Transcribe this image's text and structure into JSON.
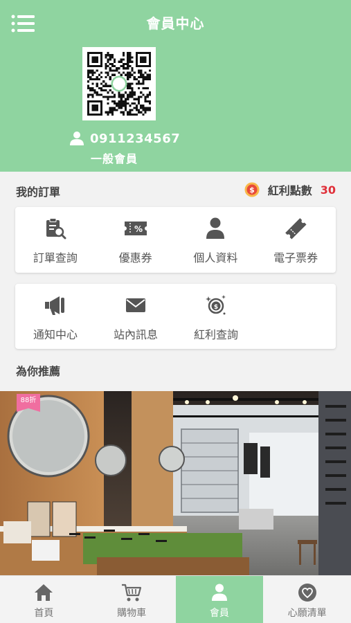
{
  "header": {
    "title": "會員中心",
    "phone": "0911234567",
    "member_level": "一般會員"
  },
  "orders": {
    "title": "我的訂單",
    "bonus_label": "紅利點數",
    "bonus_value": "30"
  },
  "grid_row1": [
    {
      "label": "訂單查詢",
      "icon": "order-search-icon"
    },
    {
      "label": "優惠券",
      "icon": "coupon-icon"
    },
    {
      "label": "個人資料",
      "icon": "profile-icon"
    },
    {
      "label": "電子票券",
      "icon": "e-ticket-icon"
    }
  ],
  "grid_row2": [
    {
      "label": "通知中心",
      "icon": "megaphone-icon"
    },
    {
      "label": "站內訊息",
      "icon": "envelope-icon"
    },
    {
      "label": "紅利查詢",
      "icon": "bonus-query-icon"
    }
  ],
  "recommend": {
    "title": "為你推薦",
    "badge": "88折"
  },
  "tabbar": [
    {
      "label": "首頁",
      "icon": "home-icon"
    },
    {
      "label": "購物車",
      "icon": "cart-icon"
    },
    {
      "label": "會員",
      "icon": "member-icon",
      "active": true
    },
    {
      "label": "心願清單",
      "icon": "heart-icon"
    }
  ],
  "colors": {
    "brand_green": "#8fd4a0",
    "bonus_red": "#e0303a",
    "badge_pink": "#f06ea0"
  }
}
